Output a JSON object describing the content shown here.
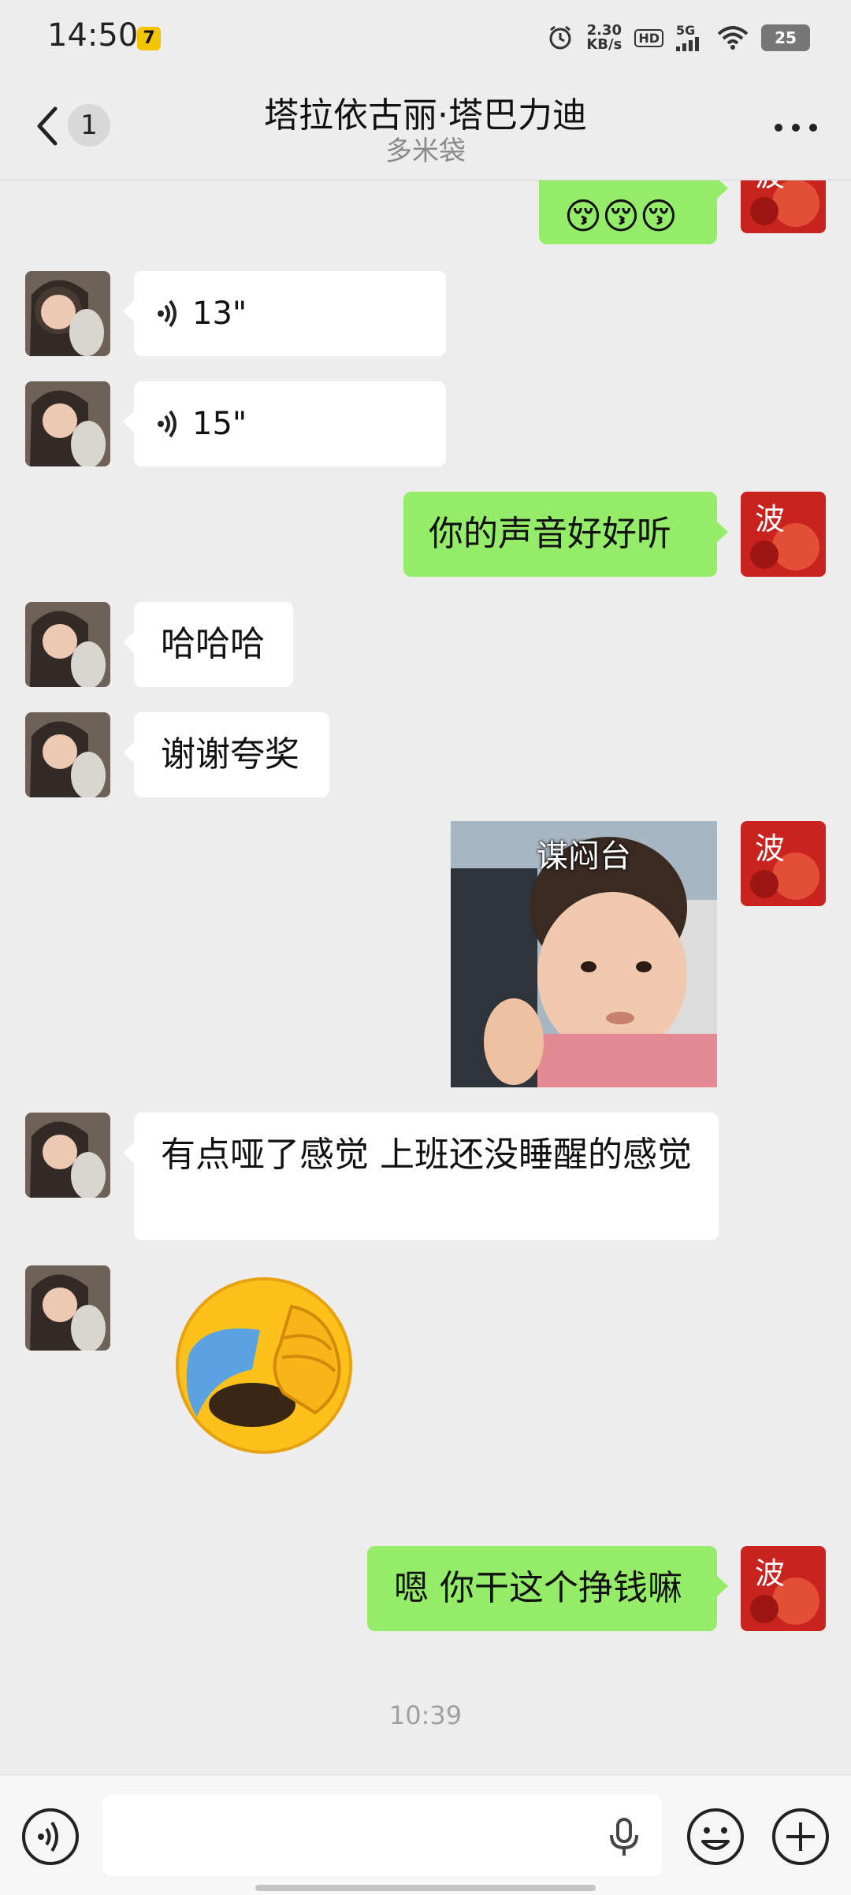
{
  "status_bar": {
    "time": "14:50",
    "app_badge": "7",
    "net_speed_value": "2.30",
    "net_speed_unit": "KB/s",
    "hd_label": "HD",
    "network_label": "5G",
    "battery_level": "25"
  },
  "header": {
    "unread_count": "1",
    "title": "塔拉依古丽·塔巴力迪",
    "subtitle": "多米袋"
  },
  "messages": [
    {
      "id": "m1",
      "direction": "out",
      "type": "emoji",
      "text": "😚😚😚"
    },
    {
      "id": "m2",
      "direction": "in",
      "type": "voice",
      "duration": "13\""
    },
    {
      "id": "m3",
      "direction": "in",
      "type": "voice",
      "duration": "15\""
    },
    {
      "id": "m4",
      "direction": "out",
      "type": "text",
      "text": "你的声音好好听"
    },
    {
      "id": "m5",
      "direction": "in",
      "type": "text",
      "text": "哈哈哈"
    },
    {
      "id": "m6",
      "direction": "in",
      "type": "text",
      "text": "谢谢夸奖"
    },
    {
      "id": "m7",
      "direction": "out",
      "type": "sticker",
      "caption": "谋闷台"
    },
    {
      "id": "m8",
      "direction": "in",
      "type": "text",
      "text": "有点哑了感觉 上班还没睡醒的感觉"
    },
    {
      "id": "m9",
      "direction": "in",
      "type": "big-emoji",
      "icon": "facepalm-crying-emoji"
    },
    {
      "id": "m10",
      "direction": "out",
      "type": "text",
      "text": "嗯 你干这个挣钱嘛"
    }
  ],
  "timestamp": "10:39",
  "input": {
    "value": "",
    "placeholder": ""
  },
  "colors": {
    "background": "#ededed",
    "outgoing_bubble": "#95ec69",
    "incoming_bubble": "#ffffff"
  },
  "icons": {
    "back": "back-arrow-icon",
    "more": "more-dots-icon",
    "voice_toggle": "voice-mode-icon",
    "mic": "microphone-icon",
    "emoji": "emoji-icon",
    "plus": "plus-icon"
  }
}
